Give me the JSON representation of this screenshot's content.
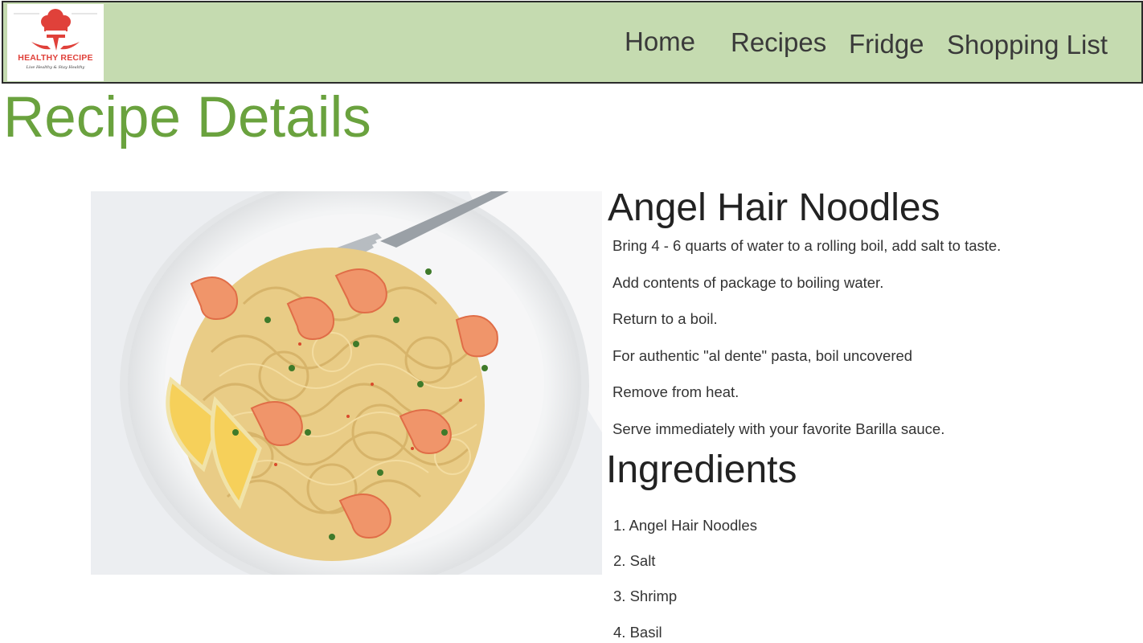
{
  "logo": {
    "name": "HEALTHY RECIPE",
    "tagline": "Live Healthy & Stay Healthy"
  },
  "nav": {
    "items": [
      {
        "label": "Home"
      },
      {
        "label": "Recipes"
      },
      {
        "label": "Fridge"
      },
      {
        "label": "Shopping List"
      }
    ]
  },
  "page": {
    "title": "Recipe Details"
  },
  "recipe": {
    "name": "Angel Hair Noodles",
    "steps": [
      "Bring 4 - 6 quarts of water to a rolling boil, add salt to taste.",
      "Add contents of package to boiling water.",
      "Return to a boil.",
      "For authentic \"al dente\" pasta, boil uncovered",
      "Remove from heat.",
      "Serve immediately with your favorite Barilla sauce."
    ],
    "ingredients_heading": "Ingredients",
    "ingredients": [
      "1. Angel Hair Noodles",
      "2. Salt",
      "3. Shrimp",
      "4. Basil"
    ]
  },
  "colors": {
    "nav_bg": "#c5dbb0",
    "title_green": "#6aa23e",
    "logo_red": "#e0413a"
  }
}
